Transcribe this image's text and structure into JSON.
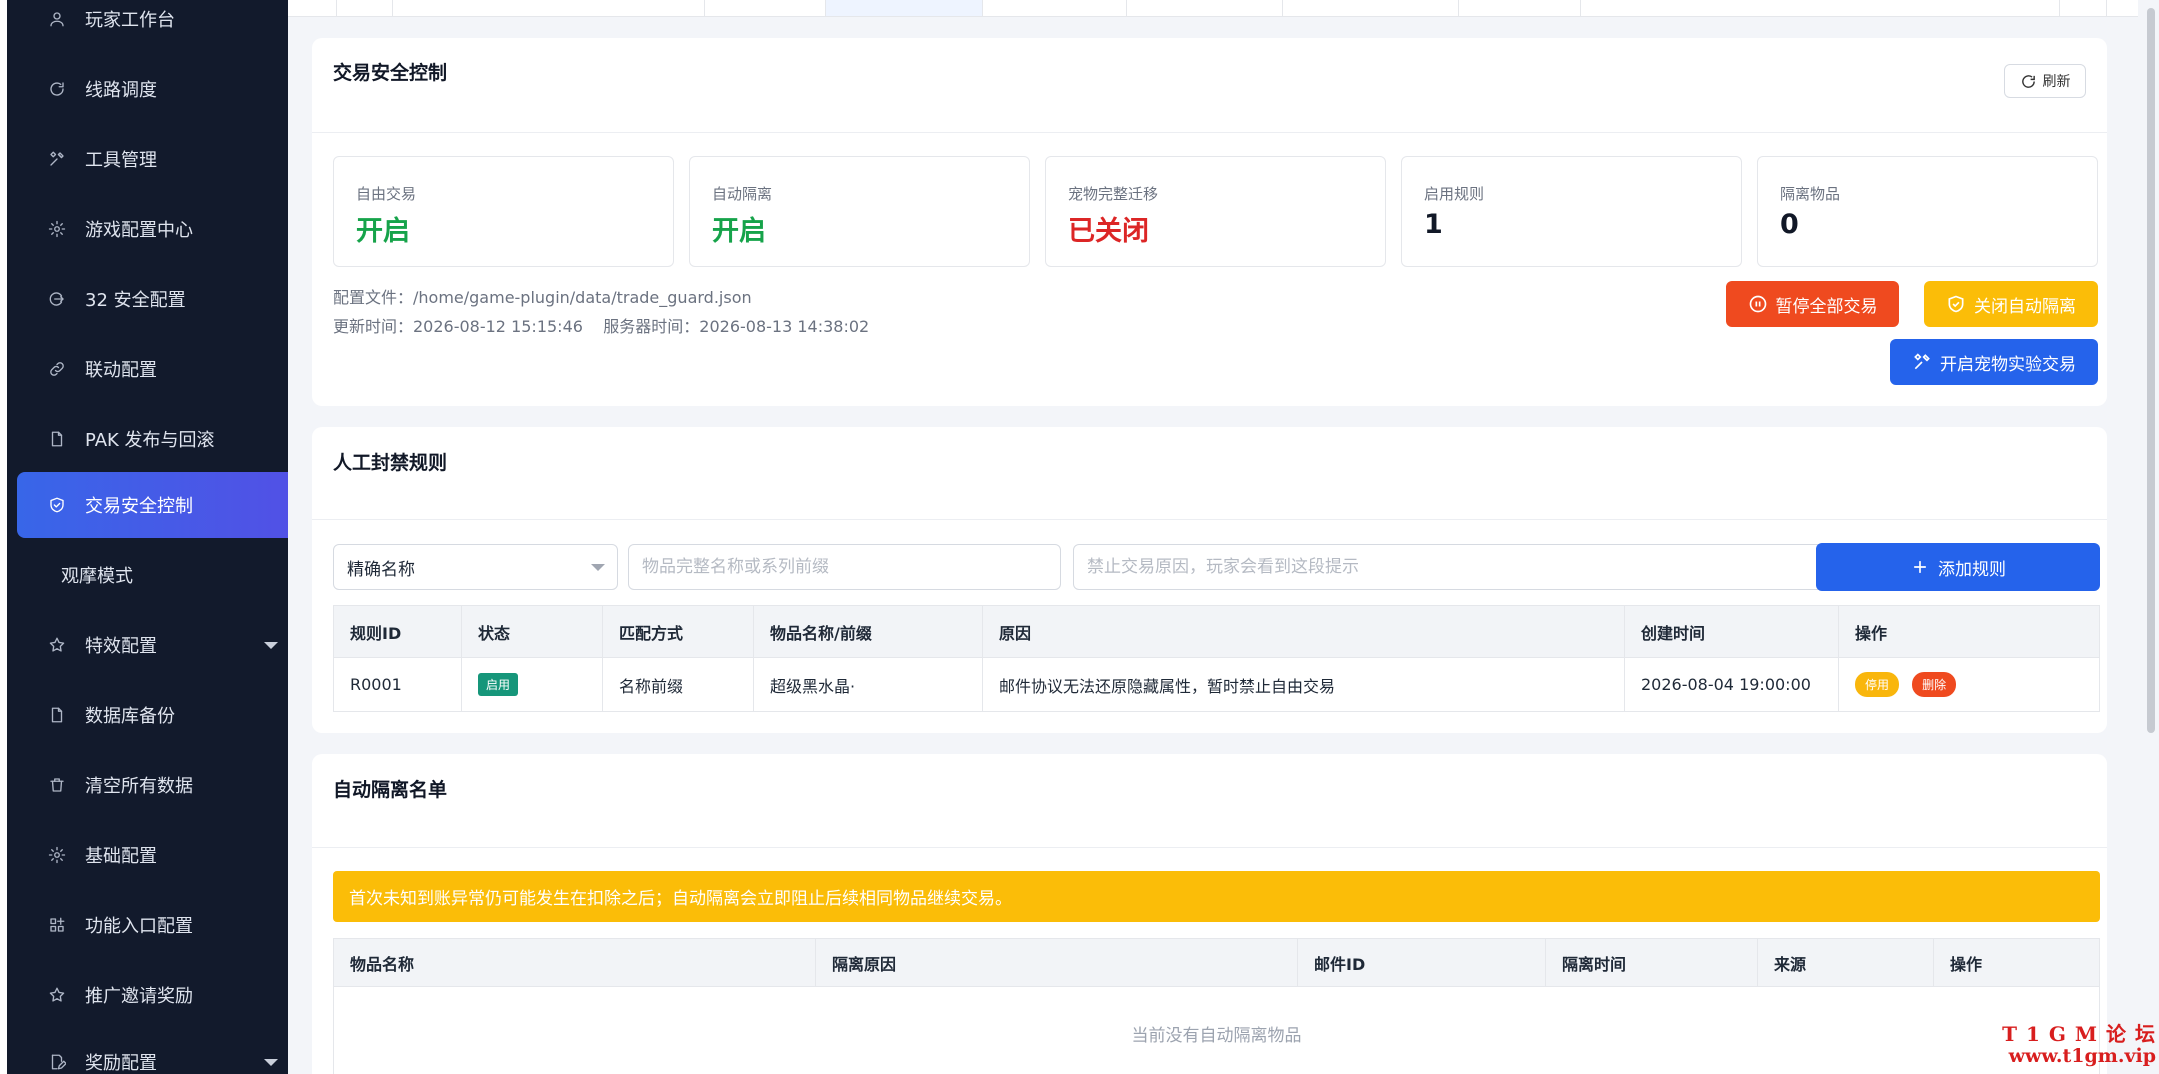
{
  "sidebar": {
    "items": [
      {
        "label": "玩家工作台",
        "icon": "user-icon"
      },
      {
        "label": "线路调度",
        "icon": "refresh-icon"
      },
      {
        "label": "工具管理",
        "icon": "tools-icon"
      },
      {
        "label": "游戏配置中心",
        "icon": "gear-icon"
      },
      {
        "label": "32 安全配置",
        "icon": "exit-icon"
      },
      {
        "label": "联动配置",
        "icon": "link-icon"
      },
      {
        "label": "PAK 发布与回滚",
        "icon": "file-icon"
      },
      {
        "label": "交易安全控制",
        "icon": "shield-icon"
      },
      {
        "label": "观摩模式",
        "icon": ""
      },
      {
        "label": "特效配置",
        "icon": "star-icon"
      },
      {
        "label": "数据库备份",
        "icon": "file-icon"
      },
      {
        "label": "清空所有数据",
        "icon": "trash-icon"
      },
      {
        "label": "基础配置",
        "icon": "gear-icon"
      },
      {
        "label": "功能入口配置",
        "icon": "grid-icon"
      },
      {
        "label": "推广邀请奖励",
        "icon": "star-icon"
      },
      {
        "label": "奖励配置",
        "icon": "edit-icon"
      }
    ],
    "active_index": 7
  },
  "trade_control": {
    "title": "交易安全控制",
    "refresh_label": "刷新",
    "stats": [
      {
        "label": "自由交易",
        "value": "开启",
        "status": "on"
      },
      {
        "label": "自动隔离",
        "value": "开启",
        "status": "on"
      },
      {
        "label": "宠物完整迁移",
        "value": "已关闭",
        "status": "off"
      },
      {
        "label": "启用规则",
        "value": "1",
        "status": "num"
      },
      {
        "label": "隔离物品",
        "value": "0",
        "status": "num"
      }
    ],
    "config_file": "配置文件：/home/game-plugin/data/trade_guard.json",
    "update_time": "更新时间：2026-08-12 15:15:46    服务器时间：2026-08-13 14:38:02",
    "pause_all_label": "暂停全部交易",
    "close_auto_isolate_label": "关闭自动隔离",
    "open_pet_trade_label": "开启宠物实验交易"
  },
  "ban_rules": {
    "title": "人工封禁规则",
    "match_select": "精确名称",
    "item_placeholder": "物品完整名称或系列前缀",
    "reason_placeholder": "禁止交易原因，玩家会看到这段提示",
    "add_label": "添加规则",
    "columns": [
      "规则ID",
      "状态",
      "匹配方式",
      "物品名称/前缀",
      "原因",
      "创建时间",
      "操作"
    ],
    "rows": [
      {
        "id": "R0001",
        "status": "启用",
        "match": "名称前缀",
        "item": "超级黑水晶·",
        "reason": "邮件协议无法还原隐藏属性，暂时禁止自由交易",
        "created": "2026-08-04 19:00:00",
        "disable_label": "停用",
        "delete_label": "删除"
      }
    ]
  },
  "isolation": {
    "title": "自动隔离名单",
    "alert": "首次未知到账异常仍可能发生在扣除之后；自动隔离会立即阻止后续相同物品继续交易。",
    "columns": [
      "物品名称",
      "隔离原因",
      "邮件ID",
      "隔离时间",
      "来源",
      "操作"
    ],
    "empty_text": "当前没有自动隔离物品"
  },
  "watermark": {
    "line1": "T 1 G M 论 坛",
    "line2": "www.t1gm.vip"
  },
  "colors": {
    "sidebar_bg": "#121a2c",
    "active_nav": "#3866e8",
    "green": "#16a34a",
    "red": "#dc2626",
    "orange": "#fbbd08",
    "blue": "#2563eb"
  }
}
